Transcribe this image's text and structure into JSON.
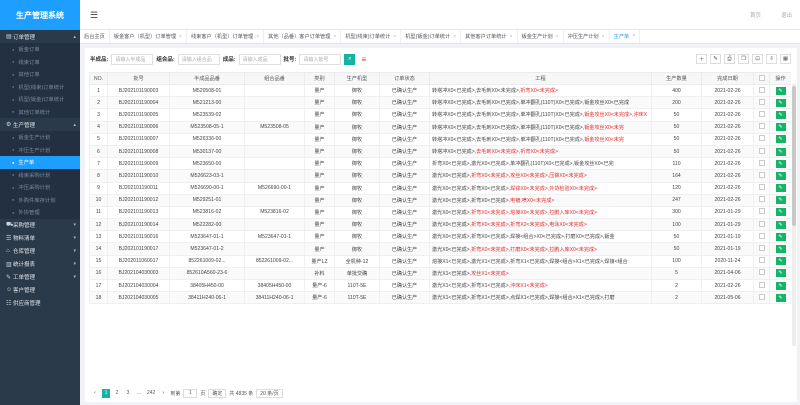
{
  "app": {
    "title": "生产管理系统"
  },
  "topbar": {
    "link1": "首页",
    "link2": "退出"
  },
  "sidebar": {
    "groups": [
      {
        "label": "订单管理",
        "icon": "▤",
        "arrow": "▴",
        "subs": [
          "钣金订单",
          "线束订单",
          "其他订单",
          "机型(线束)订单统计",
          "机型(钣金)订单统计",
          "其他订单统计"
        ]
      },
      {
        "label": "生产管理",
        "icon": "⚙",
        "arrow": "▴",
        "subs": [
          "钣金生产计划",
          "冲压生产计划",
          "生产单",
          "线束采购计划",
          "冲压采购计划",
          "外购件库存计划",
          "外协管理"
        ]
      },
      {
        "label": "采购管理",
        "icon": "⛟",
        "arrow": "▾",
        "subs": []
      },
      {
        "label": "物料清单",
        "icon": "☰",
        "arrow": "▾",
        "subs": []
      },
      {
        "label": "仓库管理",
        "icon": "⌂",
        "arrow": "▾",
        "subs": []
      },
      {
        "label": "统计报表",
        "icon": "▥",
        "arrow": "▾",
        "subs": []
      },
      {
        "label": "工单管理",
        "icon": "✎",
        "arrow": "▾",
        "subs": []
      },
      {
        "label": "客户管理",
        "icon": "☺",
        "arrow": "",
        "subs": []
      },
      {
        "label": "供应商管理",
        "icon": "☷",
        "arrow": "",
        "subs": []
      }
    ],
    "active_sub": "生产单"
  },
  "tabs": [
    {
      "label": "后台主页",
      "closable": false
    },
    {
      "label": "钣金客户（机型）订单管理",
      "closable": true
    },
    {
      "label": "线束客户（机型）订单管理",
      "closable": true
    },
    {
      "label": "其他（品番）客户订单管理",
      "closable": true
    },
    {
      "label": "机型(线束)订单统计",
      "closable": true
    },
    {
      "label": "机型(钣金)订单统计",
      "closable": true
    },
    {
      "label": "其他客户订单统计",
      "closable": true
    },
    {
      "label": "钣金生产计划",
      "closable": true
    },
    {
      "label": "冲压生产计划",
      "closable": true
    },
    {
      "label": "生产单",
      "closable": true,
      "active": true
    }
  ],
  "filters": [
    {
      "label": "半成品:",
      "placeholder": "请输入半成品"
    },
    {
      "label": "组合品:",
      "placeholder": "请输入组合品"
    },
    {
      "label": "成品:",
      "placeholder": "请输入成品"
    },
    {
      "label": "批号:",
      "placeholder": "请输入批号"
    }
  ],
  "toolbar_icons": [
    "add-icon",
    "edit-icon",
    "print-icon",
    "copy-icon",
    "lock-icon",
    "export-icon",
    "filter-icon"
  ],
  "table": {
    "columns": [
      "NO.",
      "批号",
      "半成品品番",
      "组合品番",
      "类别",
      "生产机型",
      "订单状态",
      "工程",
      "生产数量",
      "完成日期",
      "",
      "操作"
    ],
    "rows": [
      {
        "no": "1",
        "lot": "BJ202101190003",
        "semi": "M520508-01",
        "combo": "",
        "cat": "量产",
        "model": "御牧",
        "status": "已确认生产",
        "proc": [
          [
            "转塔冲X0<已完成>",
            "d"
          ],
          [
            ",去毛刺X0<未完成>",
            ""
          ],
          [
            ",折弯X0<未完成>",
            "r"
          ]
        ],
        "qty": "400",
        "date": "2021-02-26"
      },
      {
        "no": "2",
        "lot": "BJ202101190004",
        "semi": "M521213-00",
        "combo": "",
        "cat": "量产",
        "model": "御牧",
        "status": "已确认生产",
        "proc": [
          [
            "转塔冲X0<已完成>,去毛刺X0<已完成>,单冲翻孔(110T)X0<已完成>,钣金攻丝X0<已完成",
            "d"
          ]
        ],
        "qty": "200",
        "date": "2021-02-26"
      },
      {
        "no": "3",
        "lot": "BJ202101190005",
        "semi": "M523539-02",
        "combo": "",
        "cat": "量产",
        "model": "御牧",
        "status": "已确认生产",
        "proc": [
          [
            "转塔冲X0<已完成>,去毛刺X0<已完成>,单冲翻孔(110T)X0<已完成>,",
            "d"
          ],
          [
            "钣金攻丝X0<未完成>,沖床X",
            "r"
          ]
        ],
        "qty": "50",
        "date": "2021-02-26"
      },
      {
        "no": "4",
        "lot": "BJ202101190006",
        "semi": "M523508-05-1",
        "combo": "M523508-05",
        "cat": "量产",
        "model": "御牧",
        "status": "已确认生产",
        "proc": [
          [
            "转塔冲X0<已完成>,去毛刺X0<已完成>,单冲翻孔(110T)X0<已完成>,",
            "d"
          ],
          [
            "钣金攻丝X0<未完",
            "r"
          ]
        ],
        "qty": "50",
        "date": "2021-02-26"
      },
      {
        "no": "5",
        "lot": "BJ202101190007",
        "semi": "M526336-00",
        "combo": "",
        "cat": "量产",
        "model": "御牧",
        "status": "已确认生产",
        "proc": [
          [
            "转塔冲X0<已完成>,去毛刺X0<已完成>,单冲翻孔(110T)X0<已完成>,",
            "d"
          ],
          [
            "钣金攻丝X0<未完",
            "r"
          ]
        ],
        "qty": "50",
        "date": "2021-02-26"
      },
      {
        "no": "6",
        "lot": "BJ202101190008",
        "semi": "M530137-00",
        "combo": "",
        "cat": "量产",
        "model": "御牧",
        "status": "已确认生产",
        "proc": [
          [
            "转塔冲X0<已完成>",
            "d"
          ],
          [
            ",去毛刺X0<未完成>,折弯X0<未完成>",
            "r"
          ]
        ],
        "qty": "50",
        "date": "2021-02-26"
      },
      {
        "no": "7",
        "lot": "BJ202101190009",
        "semi": "M523650-00",
        "combo": "",
        "cat": "量产",
        "model": "御牧",
        "status": "已确认生产",
        "proc": [
          [
            "折弯X0<已完成>,激光X0<已完成>,单冲翻孔(110T)X0<已完成>,钣金攻丝X0<已完",
            "d"
          ]
        ],
        "qty": "110",
        "date": "2021-02-26"
      },
      {
        "no": "8",
        "lot": "BJ202101190010",
        "semi": "M526623-03-1",
        "combo": "",
        "cat": "量产",
        "model": "御牧",
        "status": "已确认生产",
        "proc": [
          [
            "激光X0<已完成>",
            "d"
          ],
          [
            ",折弯X0<未完成>,攻丝X0<未完成>,压铆X0<未完成>",
            "r"
          ]
        ],
        "qty": "164",
        "date": "2021-02-26"
      },
      {
        "no": "9",
        "lot": "BJ202101190011",
        "semi": "M526690-00-1",
        "combo": "M526690-00-1",
        "cat": "量产",
        "model": "御牧",
        "status": "已确认生产",
        "proc": [
          [
            "激光X0<已完成>,折弯X0<已完成>",
            "d"
          ],
          [
            ",焊锌X0<未完成>,外协检验X0<未完成>",
            "r"
          ]
        ],
        "qty": "120",
        "date": "2021-02-26"
      },
      {
        "no": "10",
        "lot": "BJ202101190012",
        "semi": "M529251-01",
        "combo": "",
        "cat": "量产",
        "model": "御牧",
        "status": "已确认生产",
        "proc": [
          [
            "激光X0<已完成>,折弯X0<已完成>",
            "d"
          ],
          [
            ",电镀,喷X0<未完成>",
            "r"
          ]
        ],
        "qty": "247",
        "date": "2021-02-26"
      },
      {
        "no": "11",
        "lot": "BJ202101190013",
        "semi": "M523816-02",
        "combo": "M523816-02",
        "cat": "量产",
        "model": "御牧",
        "status": "已确认生产",
        "proc": [
          [
            "激光X0<已完成>",
            "d"
          ],
          [
            ",折弯X0<未完成>,熔接X0<未完成>,拉鹏入库X0<未完成>",
            "r"
          ]
        ],
        "qty": "300",
        "date": "2021-01-29"
      },
      {
        "no": "12",
        "lot": "BJ202101190014",
        "semi": "M522282-00",
        "combo": "",
        "cat": "量产",
        "model": "御牧",
        "status": "已确认生产",
        "proc": [
          [
            "激光X0<已完成>",
            "d"
          ],
          [
            ",折弯X0<未完成>,折弯X2<未完成>,电泳X0<未完成>",
            "r"
          ]
        ],
        "qty": "100",
        "date": "2021-01-29"
      },
      {
        "no": "13",
        "lot": "BJ202101190016",
        "semi": "M523647-01-1",
        "combo": "M523647-01-1",
        "cat": "量产",
        "model": "御牧",
        "status": "已确认生产",
        "proc": [
          [
            "激光X0<已完成>,折弯X0<已完成>,焊接<组合>X0<已完成>,打磨X0<已完成>,钣金",
            "d"
          ]
        ],
        "qty": "50",
        "date": "2021-01-19"
      },
      {
        "no": "14",
        "lot": "BJ202101190017",
        "semi": "M523647-01-2",
        "combo": "",
        "cat": "量产",
        "model": "御牧",
        "status": "已确认生产",
        "proc": [
          [
            "激光X0<已完成>",
            "d"
          ],
          [
            ",折弯X0<未完成>,打磨X0<未完成>,拉鹏入库X0<未完成>",
            "r"
          ]
        ],
        "qty": "50",
        "date": "2021-01-19"
      },
      {
        "no": "15",
        "lot": "BJ202011060017",
        "semi": "852261009-02...",
        "combo": "852261009-02...",
        "cat": "量产LZ",
        "model": "全机种-12",
        "status": "已确认生产",
        "proc": [
          [
            "熔接X1<已完成>,激光X1<已完成>,折弯X1<已完成>,焊接<组合>X1<已完成>,焊接<组合",
            "d"
          ]
        ],
        "qty": "100",
        "date": "2020-11-24"
      },
      {
        "no": "16",
        "lot": "BJ202104030003",
        "semi": "852610A560-23-6",
        "combo": "",
        "cat": "补料",
        "model": "单批交确",
        "status": "已确认生产",
        "proc": [
          [
            "激光X1<已完成>",
            "d"
          ],
          [
            ",攻丝X1<未完成>",
            "r"
          ]
        ],
        "qty": "5",
        "date": "2021-04-06"
      },
      {
        "no": "17",
        "lot": "BJ202104030004",
        "semi": "38405H450-00",
        "combo": "38405H450-00",
        "cat": "量产-6",
        "model": "110T-5E",
        "status": "已确认生产",
        "proc": [
          [
            "激光X1<已完成>,折弯X1<已完成>",
            "d"
          ],
          [
            ",沖床X1<未完成>",
            "r"
          ]
        ],
        "qty": "2",
        "date": "2021-02-26"
      },
      {
        "no": "18",
        "lot": "BJ202104030005",
        "semi": "38411H240-06-1",
        "combo": "38411H240-06-1",
        "cat": "量产-6",
        "model": "110T-5E",
        "status": "已确认生产",
        "proc": [
          [
            "激光X1<已完成>,折弯X1<已完成>,点焊X1<已完成>,焊接<组合>X1<已完成>,打磨",
            "d"
          ]
        ],
        "qty": "2",
        "date": "2021-05-06"
      }
    ]
  },
  "pager": {
    "prev": "‹",
    "p1": "1",
    "p2": "2",
    "p3": "3",
    "ellipsis": "...",
    "plast": "242",
    "next": "›",
    "goto_label": "到第",
    "goto_value": "1",
    "page_unit": "页",
    "confirm": "确定",
    "total": "共 4835 条",
    "per_page": "20 条/页"
  },
  "colors": {
    "accent": "#1e9fff",
    "sidebar": "#2b3a4a",
    "ok": "#16b369",
    "teal": "#16b3a3",
    "alert": "#e02a2a"
  }
}
